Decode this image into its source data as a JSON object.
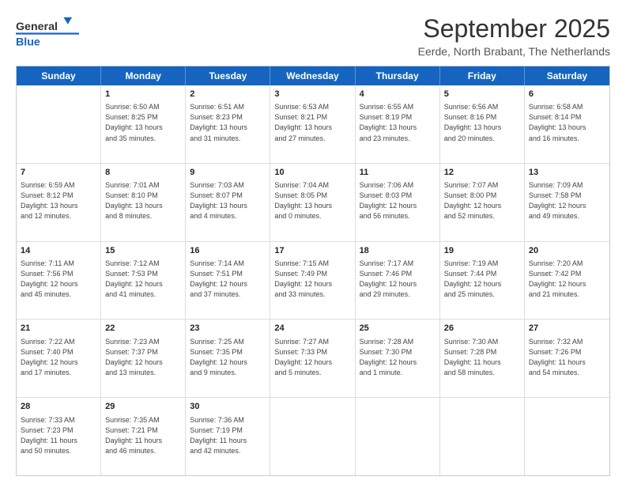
{
  "header": {
    "logo_line1": "General",
    "logo_line2": "Blue",
    "title": "September 2025",
    "subtitle": "Eerde, North Brabant, The Netherlands"
  },
  "calendar": {
    "days": [
      "Sunday",
      "Monday",
      "Tuesday",
      "Wednesday",
      "Thursday",
      "Friday",
      "Saturday"
    ],
    "rows": [
      [
        {
          "day": "",
          "info": ""
        },
        {
          "day": "1",
          "info": "Sunrise: 6:50 AM\nSunset: 8:25 PM\nDaylight: 13 hours\nand 35 minutes."
        },
        {
          "day": "2",
          "info": "Sunrise: 6:51 AM\nSunset: 8:23 PM\nDaylight: 13 hours\nand 31 minutes."
        },
        {
          "day": "3",
          "info": "Sunrise: 6:53 AM\nSunset: 8:21 PM\nDaylight: 13 hours\nand 27 minutes."
        },
        {
          "day": "4",
          "info": "Sunrise: 6:55 AM\nSunset: 8:19 PM\nDaylight: 13 hours\nand 23 minutes."
        },
        {
          "day": "5",
          "info": "Sunrise: 6:56 AM\nSunset: 8:16 PM\nDaylight: 13 hours\nand 20 minutes."
        },
        {
          "day": "6",
          "info": "Sunrise: 6:58 AM\nSunset: 8:14 PM\nDaylight: 13 hours\nand 16 minutes."
        }
      ],
      [
        {
          "day": "7",
          "info": "Sunrise: 6:59 AM\nSunset: 8:12 PM\nDaylight: 13 hours\nand 12 minutes."
        },
        {
          "day": "8",
          "info": "Sunrise: 7:01 AM\nSunset: 8:10 PM\nDaylight: 13 hours\nand 8 minutes."
        },
        {
          "day": "9",
          "info": "Sunrise: 7:03 AM\nSunset: 8:07 PM\nDaylight: 13 hours\nand 4 minutes."
        },
        {
          "day": "10",
          "info": "Sunrise: 7:04 AM\nSunset: 8:05 PM\nDaylight: 13 hours\nand 0 minutes."
        },
        {
          "day": "11",
          "info": "Sunrise: 7:06 AM\nSunset: 8:03 PM\nDaylight: 12 hours\nand 56 minutes."
        },
        {
          "day": "12",
          "info": "Sunrise: 7:07 AM\nSunset: 8:00 PM\nDaylight: 12 hours\nand 52 minutes."
        },
        {
          "day": "13",
          "info": "Sunrise: 7:09 AM\nSunset: 7:58 PM\nDaylight: 12 hours\nand 49 minutes."
        }
      ],
      [
        {
          "day": "14",
          "info": "Sunrise: 7:11 AM\nSunset: 7:56 PM\nDaylight: 12 hours\nand 45 minutes."
        },
        {
          "day": "15",
          "info": "Sunrise: 7:12 AM\nSunset: 7:53 PM\nDaylight: 12 hours\nand 41 minutes."
        },
        {
          "day": "16",
          "info": "Sunrise: 7:14 AM\nSunset: 7:51 PM\nDaylight: 12 hours\nand 37 minutes."
        },
        {
          "day": "17",
          "info": "Sunrise: 7:15 AM\nSunset: 7:49 PM\nDaylight: 12 hours\nand 33 minutes."
        },
        {
          "day": "18",
          "info": "Sunrise: 7:17 AM\nSunset: 7:46 PM\nDaylight: 12 hours\nand 29 minutes."
        },
        {
          "day": "19",
          "info": "Sunrise: 7:19 AM\nSunset: 7:44 PM\nDaylight: 12 hours\nand 25 minutes."
        },
        {
          "day": "20",
          "info": "Sunrise: 7:20 AM\nSunset: 7:42 PM\nDaylight: 12 hours\nand 21 minutes."
        }
      ],
      [
        {
          "day": "21",
          "info": "Sunrise: 7:22 AM\nSunset: 7:40 PM\nDaylight: 12 hours\nand 17 minutes."
        },
        {
          "day": "22",
          "info": "Sunrise: 7:23 AM\nSunset: 7:37 PM\nDaylight: 12 hours\nand 13 minutes."
        },
        {
          "day": "23",
          "info": "Sunrise: 7:25 AM\nSunset: 7:35 PM\nDaylight: 12 hours\nand 9 minutes."
        },
        {
          "day": "24",
          "info": "Sunrise: 7:27 AM\nSunset: 7:33 PM\nDaylight: 12 hours\nand 5 minutes."
        },
        {
          "day": "25",
          "info": "Sunrise: 7:28 AM\nSunset: 7:30 PM\nDaylight: 12 hours\nand 1 minute."
        },
        {
          "day": "26",
          "info": "Sunrise: 7:30 AM\nSunset: 7:28 PM\nDaylight: 11 hours\nand 58 minutes."
        },
        {
          "day": "27",
          "info": "Sunrise: 7:32 AM\nSunset: 7:26 PM\nDaylight: 11 hours\nand 54 minutes."
        }
      ],
      [
        {
          "day": "28",
          "info": "Sunrise: 7:33 AM\nSunset: 7:23 PM\nDaylight: 11 hours\nand 50 minutes."
        },
        {
          "day": "29",
          "info": "Sunrise: 7:35 AM\nSunset: 7:21 PM\nDaylight: 11 hours\nand 46 minutes."
        },
        {
          "day": "30",
          "info": "Sunrise: 7:36 AM\nSunset: 7:19 PM\nDaylight: 11 hours\nand 42 minutes."
        },
        {
          "day": "",
          "info": ""
        },
        {
          "day": "",
          "info": ""
        },
        {
          "day": "",
          "info": ""
        },
        {
          "day": "",
          "info": ""
        }
      ]
    ]
  }
}
